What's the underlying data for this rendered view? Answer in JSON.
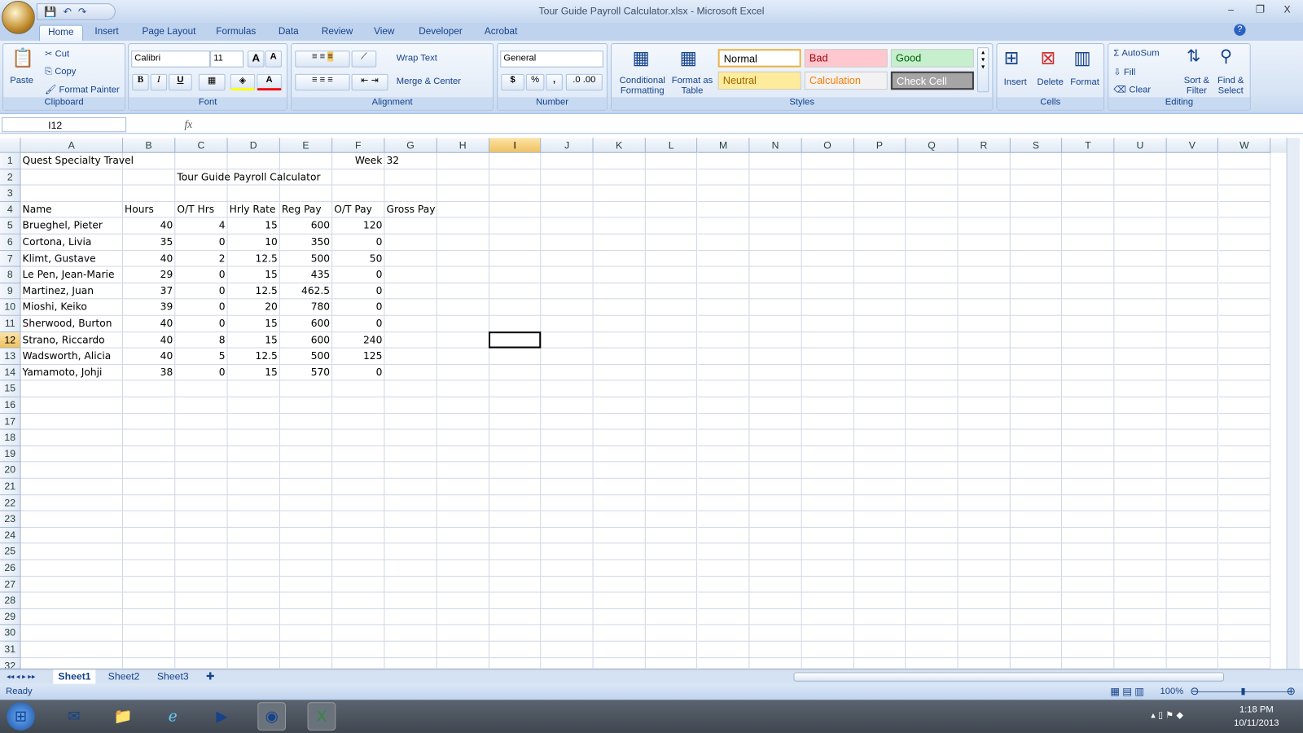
{
  "window": {
    "title": "Tour Guide Payroll Calculator.xlsx - Microsoft Excel",
    "minimize": "–",
    "restore": "❐",
    "close": "X",
    "help": "?"
  },
  "tabs": [
    "Home",
    "Insert",
    "Page Layout",
    "Formulas",
    "Data",
    "Review",
    "View",
    "Developer",
    "Acrobat"
  ],
  "ribbon": {
    "clipboard": {
      "label": "Clipboard",
      "paste": "Paste",
      "cut": "Cut",
      "copy": "Copy",
      "format_painter": "Format Painter"
    },
    "font": {
      "label": "Font",
      "name": "Calibri",
      "size": "11",
      "bold": "B",
      "italic": "I",
      "underline": "U",
      "grow": "A",
      "shrink": "A",
      "font_color": "A"
    },
    "alignment": {
      "label": "Alignment",
      "wrap_text": "Wrap Text",
      "merge_center": "Merge & Center"
    },
    "number": {
      "label": "Number",
      "format": "General",
      "currency": "$",
      "percent": "%",
      "comma": ","
    },
    "styles": {
      "label": "Styles",
      "conditional": "Conditional Formatting",
      "format_table": "Format as Table",
      "gallery": [
        {
          "name": "Normal",
          "bg": "#ffffff",
          "fg": "#000000"
        },
        {
          "name": "Bad",
          "bg": "#ffc7ce",
          "fg": "#9c0006"
        },
        {
          "name": "Good",
          "bg": "#c6efce",
          "fg": "#006100"
        },
        {
          "name": "Neutral",
          "bg": "#ffeb9c",
          "fg": "#9c6500"
        },
        {
          "name": "Calculation",
          "bg": "#f2f2f2",
          "fg": "#fa7d00"
        },
        {
          "name": "Check Cell",
          "bg": "#a5a5a5",
          "fg": "#ffffff"
        }
      ]
    },
    "cells": {
      "label": "Cells",
      "insert": "Insert",
      "delete": "Delete",
      "format": "Format"
    },
    "editing": {
      "label": "Editing",
      "autosum": "AutoSum",
      "fill": "Fill",
      "clear": "Clear",
      "sort_filter": "Sort & Filter",
      "find_select": "Find & Select"
    }
  },
  "formula_bar": {
    "name_box": "I12",
    "fx": "fx",
    "value": ""
  },
  "grid": {
    "columns": [
      "A",
      "B",
      "C",
      "D",
      "E",
      "F",
      "G",
      "H",
      "I",
      "J",
      "K",
      "L",
      "M",
      "N",
      "O",
      "P",
      "Q",
      "R",
      "S",
      "T",
      "U",
      "V",
      "W"
    ],
    "row_count": 32,
    "active_cell": "I12",
    "rows": [
      [
        "Quest Specialty Travel",
        "",
        "",
        "",
        "",
        "Week",
        "32"
      ],
      [
        "",
        "",
        "Tour Guide Payroll Calculator",
        "",
        "",
        "",
        ""
      ],
      [
        "",
        "",
        "",
        "",
        "",
        "",
        ""
      ],
      [
        "Name",
        "Hours",
        "O/T Hrs",
        "Hrly Rate",
        "Reg Pay",
        "O/T Pay",
        "Gross Pay"
      ],
      [
        "Brueghel, Pieter",
        "40",
        "4",
        "15",
        "600",
        "120",
        ""
      ],
      [
        "Cortona, Livia",
        "35",
        "0",
        "10",
        "350",
        "0",
        ""
      ],
      [
        "Klimt, Gustave",
        "40",
        "2",
        "12.5",
        "500",
        "50",
        ""
      ],
      [
        "Le Pen, Jean-Marie",
        "29",
        "0",
        "15",
        "435",
        "0",
        ""
      ],
      [
        "Martinez, Juan",
        "37",
        "0",
        "12.5",
        "462.5",
        "0",
        ""
      ],
      [
        "Mioshi, Keiko",
        "39",
        "0",
        "20",
        "780",
        "0",
        ""
      ],
      [
        "Sherwood, Burton",
        "40",
        "0",
        "15",
        "600",
        "0",
        ""
      ],
      [
        "Strano, Riccardo",
        "40",
        "8",
        "15",
        "600",
        "240",
        ""
      ],
      [
        "Wadsworth, Alicia",
        "40",
        "5",
        "12.5",
        "500",
        "125",
        ""
      ],
      [
        "Yamamoto, Johji",
        "38",
        "0",
        "15",
        "570",
        "0",
        ""
      ]
    ]
  },
  "sheets": [
    "Sheet1",
    "Sheet2",
    "Sheet3"
  ],
  "active_sheet": "Sheet1",
  "status": {
    "text": "Ready",
    "zoom": "100%"
  },
  "taskbar": {
    "time": "1:18 PM",
    "date": "10/11/2013"
  }
}
